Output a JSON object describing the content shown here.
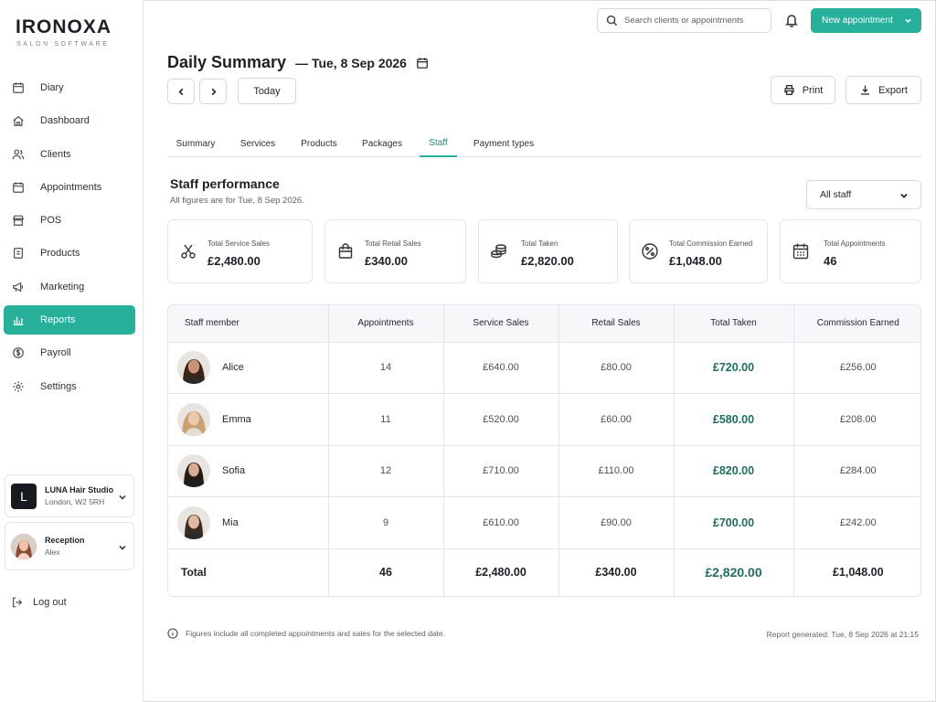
{
  "brand": {
    "name": "IRONOXA",
    "tagline": "SALON SOFTWARE"
  },
  "sidebar": {
    "items": [
      {
        "label": "Diary",
        "icon": "calendar-icon",
        "active": false
      },
      {
        "label": "Dashboard",
        "icon": "home-icon",
        "active": false
      },
      {
        "label": "Clients",
        "icon": "users-icon",
        "active": false
      },
      {
        "label": "Appointments",
        "icon": "calendar-icon",
        "active": false
      },
      {
        "label": "POS",
        "icon": "shop-icon",
        "active": false
      },
      {
        "label": "Products",
        "icon": "box-icon",
        "active": false
      },
      {
        "label": "Marketing",
        "icon": "megaphone-icon",
        "active": false
      },
      {
        "label": "Reports",
        "icon": "bar-chart-icon",
        "active": true
      },
      {
        "label": "Payroll",
        "icon": "coin-icon",
        "active": false
      },
      {
        "label": "Settings",
        "icon": "gear-icon",
        "active": false
      }
    ],
    "studio": {
      "initial": "L",
      "name": "LUNA Hair Studio",
      "location": "London, W2 5RH"
    },
    "user": {
      "role": "Reception",
      "name": "Alex"
    },
    "logout_label": "Log out"
  },
  "topbar": {
    "search_placeholder": "Search clients or appointments",
    "new_appointment_label": "New appointment"
  },
  "header": {
    "title": "Daily Summary",
    "date": "— Tue, 8 Sep 2026",
    "today_label": "Today",
    "print_label": "Print",
    "export_label": "Export"
  },
  "tabs": [
    "Summary",
    "Services",
    "Products",
    "Packages",
    "Staff",
    "Payment types"
  ],
  "active_tab": "Staff",
  "section": {
    "title": "Staff performance",
    "subtitle": "All figures are for Tue, 8 Sep 2026.",
    "filter_value": "All staff"
  },
  "kpis": [
    {
      "label": "Total Service Sales",
      "value": "£2,480.00",
      "icon": "scissors-icon"
    },
    {
      "label": "Total Retail Sales",
      "value": "£340.00",
      "icon": "shopping-bag-icon"
    },
    {
      "label": "Total Taken",
      "value": "£2,820.00",
      "icon": "coins-icon"
    },
    {
      "label": "Total Commission Earned",
      "value": "£1,048.00",
      "icon": "percent-icon"
    },
    {
      "label": "Total Appointments",
      "value": "46",
      "icon": "calendar-grid-icon"
    }
  ],
  "table": {
    "columns": [
      "Staff member",
      "Appointments",
      "Service Sales",
      "Retail Sales",
      "Total Taken",
      "Commission Earned"
    ],
    "rows": [
      {
        "name": "Alice",
        "appointments": "14",
        "service": "£640.00",
        "retail": "£80.00",
        "taken": "£720.00",
        "commission": "£256.00"
      },
      {
        "name": "Emma",
        "appointments": "11",
        "service": "£520.00",
        "retail": "£60.00",
        "taken": "£580.00",
        "commission": "£208.00"
      },
      {
        "name": "Sofia",
        "appointments": "12",
        "service": "£710.00",
        "retail": "£110.00",
        "taken": "£820.00",
        "commission": "£284.00"
      },
      {
        "name": "Mia",
        "appointments": "9",
        "service": "£610.00",
        "retail": "£90.00",
        "taken": "£700.00",
        "commission": "£242.00"
      }
    ],
    "total": {
      "label": "Total",
      "appointments": "46",
      "service": "£2,480.00",
      "retail": "£340.00",
      "taken": "£2,820.00",
      "commission": "£1,048.00"
    }
  },
  "footer": {
    "note": "Figures include all completed appointments and sales for the selected date.",
    "generated": "Report generated: Tue, 8 Sep 2026 at 21:15"
  },
  "colors": {
    "accent": "#26b09a",
    "taken_text": "#1f6e5f"
  }
}
